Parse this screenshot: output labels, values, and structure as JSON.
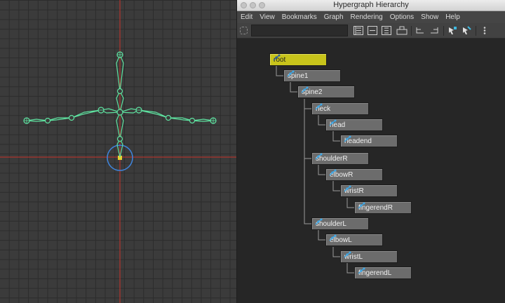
{
  "window": {
    "title": "Hypergraph Hierarchy"
  },
  "menu": [
    "Edit",
    "View",
    "Bookmarks",
    "Graph",
    "Rendering",
    "Options",
    "Show",
    "Help"
  ],
  "toolbar": {
    "search_value": "",
    "icons": [
      "lasso-select-icon",
      "hierarchy-view-icon",
      "collapse-icon",
      "expand-icon",
      "graph-icon",
      "input-connections-icon",
      "output-connections-icon",
      "bookmark-icon",
      "create-bookmark-icon",
      "more-options-icon"
    ]
  },
  "graph": {
    "nodes": [
      {
        "label": "root",
        "selected": true
      },
      {
        "label": "spine1"
      },
      {
        "label": "spine2"
      },
      {
        "label": "neck"
      },
      {
        "label": "head"
      },
      {
        "label": "headend"
      },
      {
        "label": "shoulderR"
      },
      {
        "label": "elbowR"
      },
      {
        "label": "wristR"
      },
      {
        "label": "fingerendR"
      },
      {
        "label": "shoulderL"
      },
      {
        "label": "elbowL"
      },
      {
        "label": "wristL"
      },
      {
        "label": "fingerendL"
      }
    ]
  },
  "colors": {
    "joint": "#5ee2a0",
    "axis": "#c8312a",
    "selected_node": "#c8c41b",
    "manipulator": "#3f86e0"
  }
}
